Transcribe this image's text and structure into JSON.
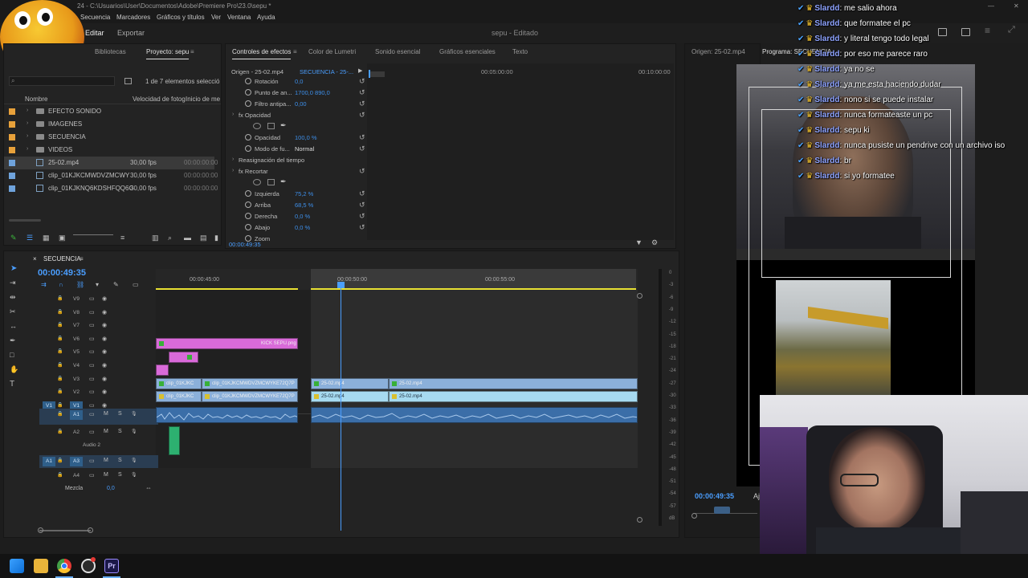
{
  "title": {
    "path": "24 - C:\\Usuarios\\User\\Documentos\\Adobe\\Premiere Pro\\23.0\\sepu *"
  },
  "menu": [
    "Secuencia",
    "Marcadores",
    "Gráficos y títulos",
    "Ver",
    "Ventana",
    "Ayuda"
  ],
  "workspace": {
    "tabs": [
      "Editar",
      "Exportar"
    ],
    "document_title": "sepu - Editado"
  },
  "project_panel": {
    "tabs": [
      "Bibliotecas",
      "Proyecto: sepu"
    ],
    "item_count": "1 de 7 elementos selecció",
    "columns": [
      "Nombre",
      "Velocidad de fotog",
      "Inicio de me"
    ],
    "items": [
      {
        "name": "EFECTO SONIDO",
        "color": "#e8a13a",
        "type": "bin",
        "fps": "",
        "tc": ""
      },
      {
        "name": "IMAGENES",
        "color": "#e8a13a",
        "type": "bin",
        "fps": "",
        "tc": ""
      },
      {
        "name": "SECUENCIA",
        "color": "#e8a13a",
        "type": "bin",
        "fps": "",
        "tc": ""
      },
      {
        "name": "VIDEOS",
        "color": "#e8a13a",
        "type": "bin",
        "fps": "",
        "tc": ""
      },
      {
        "name": "25-02.mp4",
        "color": "#6fa3dc",
        "type": "clip",
        "fps": "30,00 fps",
        "tc": "00:00:00:00"
      },
      {
        "name": "clip_01KJKCMWDVZMCWY",
        "color": "#6fa3dc",
        "type": "clip",
        "fps": "30,00 fps",
        "tc": "00:00:00:00"
      },
      {
        "name": "clip_01KJKNQ6KDSHFQQ6G",
        "color": "#6fa3dc",
        "type": "clip",
        "fps": "30,00 fps",
        "tc": "00:00:00:00"
      }
    ]
  },
  "effect_controls": {
    "tabs": [
      "Controles de efectos",
      "Color de Lumetri",
      "Sonido esencial",
      "Gráficos esenciales",
      "Texto"
    ],
    "source_label": "Origen - 25-02.mp4",
    "sequence_label": "SECUENCIA - 25-...",
    "ruler_marks": [
      "00:05:00:00",
      "00:10:00:00"
    ],
    "rows": [
      {
        "label": "Rotación",
        "value": "0,0",
        "indent": 3
      },
      {
        "label": "Punto de an...",
        "value": "1700,0    890,0",
        "indent": 3
      },
      {
        "label": "Filtro antipa...",
        "value": "0,00",
        "indent": 3
      },
      {
        "label": "fx  Opacidad",
        "value": "",
        "indent": 1
      },
      {
        "label": "",
        "value": "",
        "indent": 2
      },
      {
        "label": "Opacidad",
        "value": "100,0 %",
        "indent": 3
      },
      {
        "label": "Modo de fu...",
        "value": "Normal",
        "indent": 3
      },
      {
        "label": "Reasignación del tiempo",
        "value": "",
        "indent": 1
      },
      {
        "label": "fx  Recortar",
        "value": "",
        "indent": 1
      },
      {
        "label": "",
        "value": "",
        "indent": 2
      },
      {
        "label": "Izquierda",
        "value": "75,2 %",
        "indent": 3
      },
      {
        "label": "Arriba",
        "value": "68,5 %",
        "indent": 3
      },
      {
        "label": "Derecha",
        "value": "0,0 %",
        "indent": 3
      },
      {
        "label": "Abajo",
        "value": "0,0 %",
        "indent": 3
      },
      {
        "label": "Zoom",
        "value": "",
        "indent": 3
      }
    ],
    "timecode": "00:00:49:35"
  },
  "monitor": {
    "tabs": [
      "Origen: 25-02.mp4",
      "Programa: SECUENCIA"
    ],
    "timecode": "00:00:49:35",
    "fit": "Aj"
  },
  "timeline": {
    "sequence_name": "SECUENCIA",
    "timecode": "00:00:49:35",
    "ruler_marks": [
      "00:00:45:00",
      "00:00:50:00",
      "00:00:55:00"
    ],
    "video_tracks": [
      "V9",
      "V8",
      "V7",
      "V6",
      "V5",
      "V4",
      "V3",
      "V2",
      "V1"
    ],
    "audio_tracks": [
      "A1",
      "A2",
      "A3",
      "A4"
    ],
    "audio2_name": "Audio 2",
    "mix_label": "Mezcla",
    "mix_value": "0,0",
    "clips": {
      "kick_image": "KICK SEPU.png",
      "v2_a": "clip_01KJKC",
      "v2_b": "clip_01KJKCMWDVZMCWYKE72Q7P",
      "v2_c": "25-02.mp4",
      "v2_d": "25-02.mp4",
      "v1_a": "clip_01KJKC",
      "v1_b": "clip_01KJKCMWDVZMCWYKE72Q7P",
      "v1_c": "25-02.mp4",
      "v1_d": "25-02.mp4"
    },
    "meter_ticks": [
      "0",
      "-3",
      "-6",
      "-9",
      "-12",
      "-15",
      "-18",
      "-21",
      "-24",
      "-27",
      "-30",
      "-33",
      "-36",
      "-39",
      "-42",
      "-45",
      "-48",
      "-51",
      "-54",
      "-57",
      "dB"
    ]
  },
  "chat": [
    {
      "user": "Slardd",
      "msg": "me salio ahora"
    },
    {
      "user": "Slardd",
      "msg": "que formatee el pc"
    },
    {
      "user": "Slardd",
      "msg": "y literal tengo todo legal"
    },
    {
      "user": "Slardd",
      "msg": "por eso me parece raro"
    },
    {
      "user": "Slardd",
      "msg": "ya no se"
    },
    {
      "user": "Slardd",
      "msg": "ya me esta haciendo dudar"
    },
    {
      "user": "Slardd",
      "msg": "nono si se puede instalar"
    },
    {
      "user": "Slardd",
      "msg": "nunca formateaste un pc"
    },
    {
      "user": "Slardd",
      "msg": "sepu ki"
    },
    {
      "user": "Slardd",
      "msg": "nunca pusiste un pendrive con un archivo iso"
    },
    {
      "user": "Slardd",
      "msg": "br"
    },
    {
      "user": "Slardd",
      "msg": "si yo formatee"
    }
  ],
  "colors": {
    "accent_blue": "#3d8ee8",
    "clip_pink": "#d96ad9",
    "clip_blue": "#8bb0da",
    "clip_light_blue": "#a6daf0",
    "audio_blue": "#3b6ea8",
    "playhead": "#4a9eff",
    "chat_user": "#8ea3ff"
  },
  "taskbar": {
    "icons": [
      "windows-start-icon",
      "file-explorer-icon",
      "chrome-icon",
      "obs-icon",
      "premiere-icon"
    ]
  }
}
